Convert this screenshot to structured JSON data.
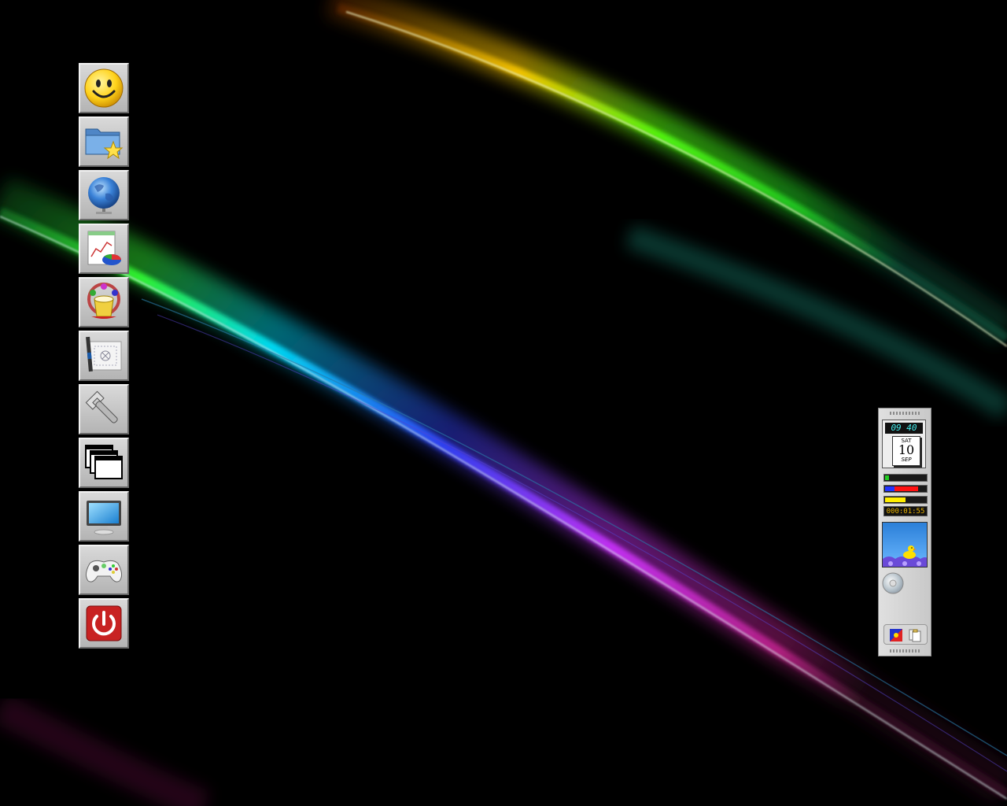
{
  "desktop": {
    "wallpaper": "abstract-light-streaks",
    "colors": [
      "#ffcc00",
      "#39ff14",
      "#00e5ff",
      "#3344ff",
      "#cc33ff"
    ]
  },
  "launcher": {
    "items": [
      {
        "icon": "smiley-icon"
      },
      {
        "icon": "favorites-folder-icon"
      },
      {
        "icon": "globe-icon"
      },
      {
        "icon": "charts-icon"
      },
      {
        "icon": "paint-bucket-icon"
      },
      {
        "icon": "blueprint-icon"
      },
      {
        "icon": "wrench-icon"
      },
      {
        "icon": "windows-icon"
      },
      {
        "icon": "monitor-icon"
      },
      {
        "icon": "gamepad-icon"
      },
      {
        "icon": "power-icon"
      }
    ]
  },
  "dock": {
    "clock": {
      "time": "09 40",
      "day": "SAT",
      "date": "10",
      "month": "SEP"
    },
    "meters": [
      {
        "name": "cpu",
        "fraction": 0.1,
        "colors": [
          "#22cc22"
        ]
      },
      {
        "name": "memory",
        "fraction": 0.8,
        "colors": [
          "#2233ff",
          "#ff1111"
        ]
      },
      {
        "name": "swap",
        "fraction": 0.5,
        "colors": [
          "#ffee00"
        ]
      }
    ],
    "uptime": "000:01:55"
  }
}
